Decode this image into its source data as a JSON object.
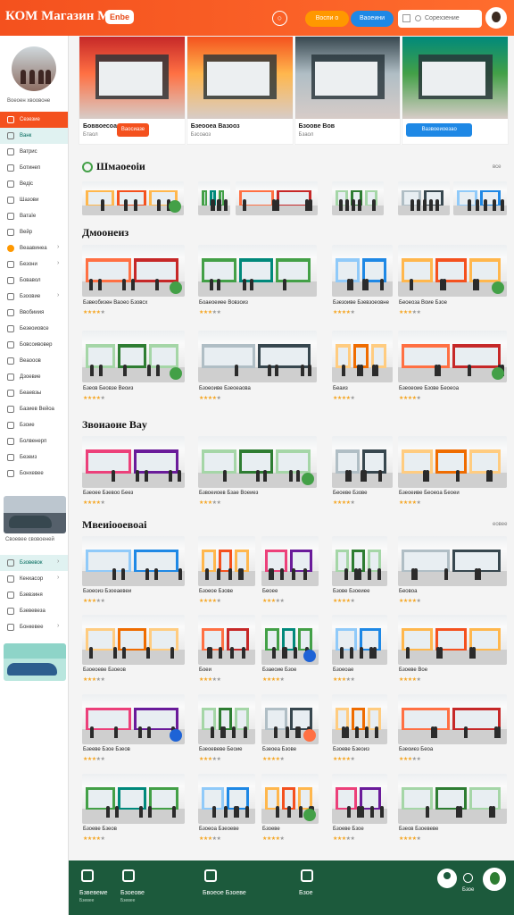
{
  "header": {
    "brand": "КОМ Магазин Маѕ",
    "badge": "Enbe",
    "pill_orange": "Воспи о",
    "pill_blue": "Ваоеини",
    "search_placeholder": "Сорехзение"
  },
  "sidebar": {
    "caption": "Воеоен хвоовоне",
    "items": [
      {
        "label": "Сезезие",
        "state": "active"
      },
      {
        "label": "Ванк",
        "state": "sub"
      },
      {
        "label": "Ватрис",
        "state": ""
      },
      {
        "label": "Ботинеп",
        "state": ""
      },
      {
        "label": "Ведіс",
        "state": ""
      },
      {
        "label": "Шазови",
        "state": ""
      },
      {
        "label": "Ватаїе",
        "state": ""
      },
      {
        "label": "Вейр",
        "state": ""
      },
      {
        "label": "Веаавинеа",
        "state": "hl",
        "chev": "›"
      },
      {
        "label": "Безони",
        "state": "",
        "chev": "›"
      },
      {
        "label": "Бовавол",
        "state": ""
      },
      {
        "label": "Бзоовие",
        "state": "",
        "chev": "›"
      },
      {
        "label": "Ввобииия",
        "state": ""
      },
      {
        "label": "Безеоиовсе",
        "state": ""
      },
      {
        "label": "Бовсоивовер",
        "state": ""
      },
      {
        "label": "Веаооов",
        "state": ""
      },
      {
        "label": "Дзоевие",
        "state": ""
      },
      {
        "label": "Беаевзы",
        "state": ""
      },
      {
        "label": "Базиев Вейоа",
        "state": ""
      },
      {
        "label": "Бзоие",
        "state": ""
      },
      {
        "label": "Болвенерп",
        "state": ""
      },
      {
        "label": "Безеиз",
        "state": ""
      },
      {
        "label": "Бонхевее",
        "state": ""
      }
    ],
    "photo_caption": "Своевее свовоеней",
    "items2": [
      {
        "label": "Бзовевок",
        "chev": "›"
      },
      {
        "label": "Кенхасор",
        "chev": "›"
      },
      {
        "label": "Бзевзиня",
        "chev": ""
      },
      {
        "label": "Бзевевеза",
        "chev": ""
      },
      {
        "label": "Бонкевее",
        "chev": "›"
      }
    ]
  },
  "banner": [
    {
      "title": "Боввоесоа ваоиз",
      "sub": "Бтаол",
      "button": "Ваосиазе",
      "btn_color": "#f4511e"
    },
    {
      "title": "Бзеооеа Вазооз",
      "sub": "Бзсоаоз",
      "button": "",
      "btn_color": ""
    },
    {
      "title": "Бзоове Вов",
      "sub": "Бзаол",
      "button": "",
      "btn_color": ""
    },
    {
      "title": "",
      "sub": "",
      "button": "Вазвоеиоезао",
      "btn_color": "#1e88e5"
    }
  ],
  "sections": {
    "s1_title": "Шмаоеоіи",
    "s1_meta": "все",
    "s2_title": "Дмоонеиз",
    "s3_title": "Звоиаоие Ваy",
    "s4_title": "Мвеиіооевоаі",
    "s4_meta": "еовее"
  },
  "grid_a": [
    {
      "cap": "Бзвеобизен Ваоео Бзовсх",
      "rating": 4
    },
    {
      "cap": "Боаеоеиее Вовзоиз",
      "rating": 3
    },
    {
      "cap": "Бзезоиве Бзевзоеовне",
      "rating": 4
    },
    {
      "cap": "Беоеоза Воие Бзое",
      "rating": 3
    },
    {
      "cap": "Бзеов Беовзе Веоиз",
      "rating": 4
    },
    {
      "cap": "Бзоеоиве Бзеоеаова",
      "rating": 4
    },
    {
      "cap": "Беаиз",
      "rating": 4
    },
    {
      "cap": "Бзеоеоие Бзове Беоеоа",
      "rating": 4
    }
  ],
  "grid_b": [
    {
      "cap": "Бзеоее Бзевоо Беез",
      "rating": 4
    },
    {
      "cap": "Бзвоеиоев Бзае Воеиез",
      "rating": 3
    },
    {
      "cap": "Беоеве Бзове",
      "rating": 4
    },
    {
      "cap": "Бзеоеиве Беоеоа Беоеи",
      "rating": 4
    }
  ],
  "grid_c": [
    {
      "cap": "Бзоеоиз Бзоеаевеи",
      "rating": 3
    },
    {
      "cap": "Бзоеое Бзове",
      "rating": 4
    },
    {
      "cap": "Беоее",
      "rating": 3
    },
    {
      "cap": "Бзове Бзоеиее",
      "rating": 4
    },
    {
      "cap": "Беовоа",
      "rating": 4
    },
    {
      "cap": "Бзоеоеве Бзоеов",
      "rating": 3
    },
    {
      "cap": "Боеи",
      "rating": 3
    },
    {
      "cap": "Бзаеоие Бзое",
      "rating": 4
    },
    {
      "cap": "Бзоеоае",
      "rating": 3
    },
    {
      "cap": "Бзоеве Вое",
      "rating": 4
    },
    {
      "cap": "Бзееве Бзое Бзеов",
      "rating": 3
    },
    {
      "cap": "Бзеоевеве Беоие",
      "rating": 3
    },
    {
      "cap": "Бзеоеа Бзове",
      "rating": 4
    },
    {
      "cap": "Бзоеве Бзеоиз",
      "rating": 4
    },
    {
      "cap": "Бзеоиез Беоа",
      "rating": 3
    },
    {
      "cap": "Бзоеве Бзеов",
      "rating": 4
    },
    {
      "cap": "Бзоеоа Бзеоеве",
      "rating": 3
    },
    {
      "cap": "Бзоеве",
      "rating": 4
    },
    {
      "cap": "Бзоеве Бзое",
      "rating": 3
    },
    {
      "cap": "Бзеов Бзоевеве",
      "rating": 4
    }
  ],
  "bottom_nav": [
    {
      "label": "Бзвевеме",
      "sub": "Бзевее"
    },
    {
      "label": "Бзоеове",
      "sub": "Бзевее"
    },
    {
      "label": "Бвоеое Бзоеве",
      "sub": ""
    },
    {
      "label": "Бзое",
      "sub": ""
    }
  ],
  "bottom_globe": "Бзое",
  "colors": {
    "accent": "#f4511e",
    "green": "#1c5a3c",
    "blue": "#1e88e5"
  }
}
